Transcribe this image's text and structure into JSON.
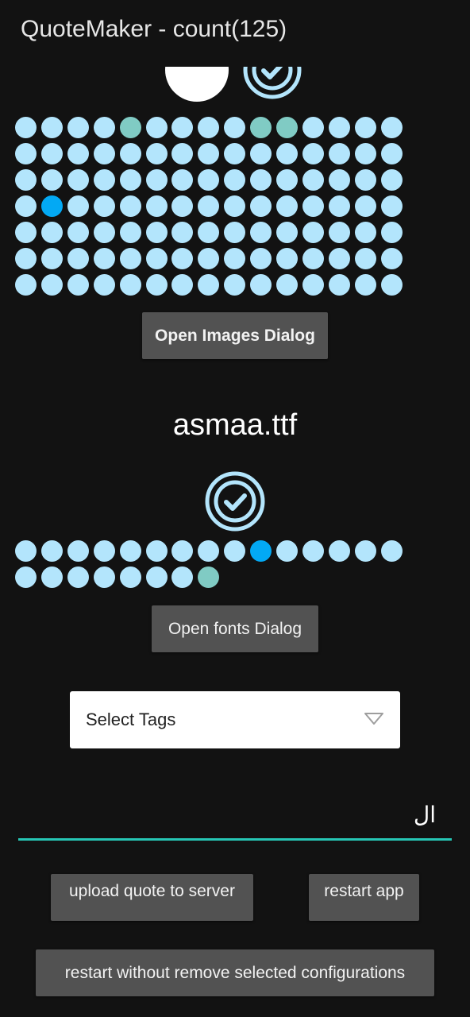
{
  "app": {
    "title": "QuoteMaker - count(125)"
  },
  "images": {
    "dot_count": 105,
    "used_indices": [
      4,
      9,
      10
    ],
    "selected_index": 46,
    "open_button_label": "Open Images Dialog"
  },
  "fonts": {
    "selected_font": "asmaa.ttf",
    "dot_count": 23,
    "used_indices": [
      22
    ],
    "selected_index": 9,
    "open_button_label": "Open fonts Dialog"
  },
  "tags": {
    "label": "Select Tags"
  },
  "quote": {
    "value": "ال"
  },
  "actions": {
    "upload_label": "upload quote to server",
    "restart_label": "restart app",
    "restart_keep_label": "restart without remove selected configurations"
  },
  "colors": {
    "background": "#121212",
    "dot_default": "#b3e5fc",
    "dot_used": "#80cbc4",
    "dot_selected": "#03a9f4",
    "accent_underline": "#26c6b5",
    "button": "#525252"
  },
  "icons": {
    "check": "check-circle-icon",
    "dropdown": "triangle-down-icon"
  }
}
